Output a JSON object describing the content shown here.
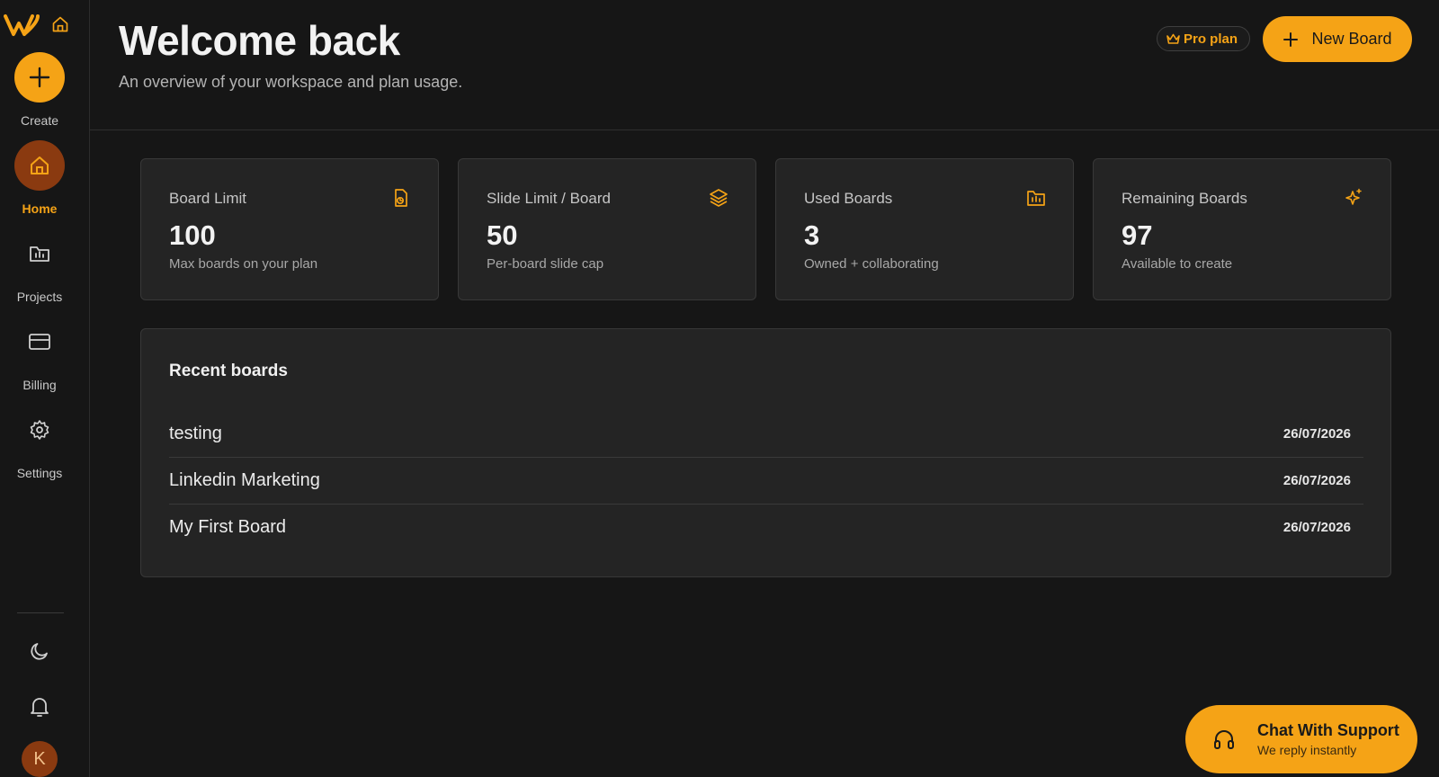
{
  "sidebar": {
    "create_label": "Create",
    "items": [
      {
        "label": "Home",
        "icon": "home-icon",
        "active": true
      },
      {
        "label": "Projects",
        "icon": "folder-chart-icon"
      },
      {
        "label": "Billing",
        "icon": "credit-card-icon"
      },
      {
        "label": "Settings",
        "icon": "gear-icon"
      }
    ],
    "avatar_initial": "K"
  },
  "header": {
    "title": "Welcome back",
    "subtitle": "An overview of your workspace and plan usage.",
    "plan_badge": "Pro plan",
    "new_board_label": "New Board"
  },
  "stats": [
    {
      "label": "Board Limit",
      "value": "100",
      "caption": "Max boards on your plan",
      "icon": "boards-icon"
    },
    {
      "label": "Slide Limit / Board",
      "value": "50",
      "caption": "Per-board slide cap",
      "icon": "layers-icon"
    },
    {
      "label": "Used Boards",
      "value": "3",
      "caption": "Owned + collaborating",
      "icon": "folder-chart-icon"
    },
    {
      "label": "Remaining Boards",
      "value": "97",
      "caption": "Available to create",
      "icon": "sparkles-icon"
    }
  ],
  "recent": {
    "title": "Recent boards",
    "boards": [
      {
        "name": "testing",
        "date": "26/07/2026"
      },
      {
        "name": "Linkedin Marketing",
        "date": "26/07/2026"
      },
      {
        "name": "My First Board",
        "date": "26/07/2026"
      }
    ]
  },
  "support": {
    "title": "Chat With Support",
    "subtitle": "We reply instantly"
  },
  "colors": {
    "accent": "#f5a316",
    "accent_dark": "#8a3a10",
    "background": "#161616",
    "card": "#242424"
  }
}
